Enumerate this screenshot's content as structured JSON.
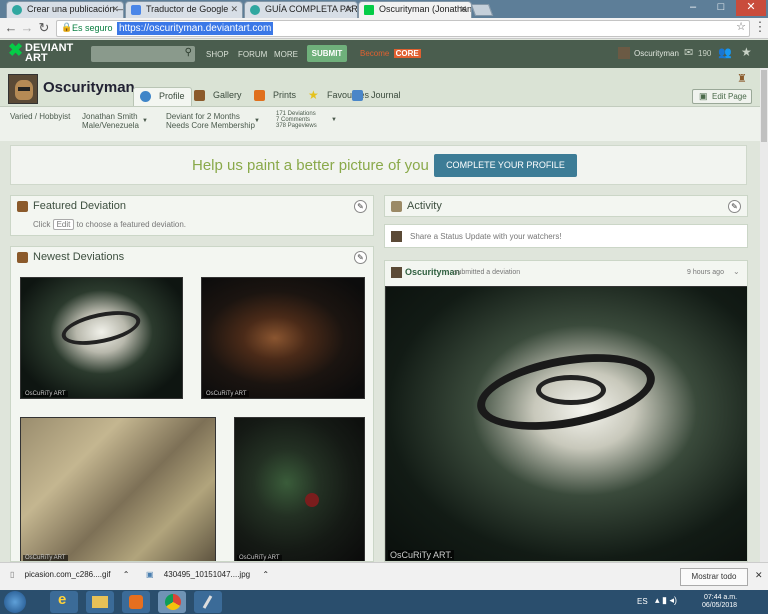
{
  "browser": {
    "tabs": [
      {
        "label": "Crear una publicación —"
      },
      {
        "label": "Traductor de Google"
      },
      {
        "label": "GUÍA COMPLETA PARA R"
      },
      {
        "label": "Oscurityman (Jonathan S"
      }
    ],
    "window_controls": {
      "minimize": "–",
      "maximize": "□",
      "close": "✕"
    },
    "secure_label": "Es seguro",
    "url": "https://oscurityman.deviantart.com"
  },
  "da_header": {
    "logo_line1": "DEVIANT",
    "logo_line2": "ART",
    "nav": [
      "SHOP",
      "FORUM",
      "MORE"
    ],
    "submit": "SUBMIT",
    "become": "Become",
    "core": "CORE",
    "username": "Oscurityman",
    "message_count": "190"
  },
  "profile": {
    "name": "Oscurityman",
    "tabs": [
      "Profile",
      "Gallery",
      "Prints",
      "Favourites",
      "Journal"
    ],
    "edit_page": "Edit Page",
    "info": {
      "type": "Varied / Hobbyist",
      "realname": "Jonathan Smith",
      "location": "Male/Venezuela",
      "deviant_for": "Deviant for 2 Months",
      "core_needed": "Needs Core Membership",
      "deviations": "171 Deviations",
      "comments": "7 Comments",
      "pageviews": "378 Pageviews"
    }
  },
  "banner": {
    "text": "Help us paint a better picture of you",
    "button": "COMPLETE YOUR PROFILE"
  },
  "featured": {
    "title": "Featured Deviation",
    "click": "Click",
    "edit": "Edit",
    "suffix": "to choose a featured deviation."
  },
  "newest": {
    "title": "Newest Deviations",
    "watermark": "OsCuRiTy ART"
  },
  "activity": {
    "title": "Activity",
    "status_placeholder": "Share a Status Update with your watchers!",
    "post_user": "Oscurityman",
    "post_action": "submitted a deviation",
    "post_time": "9 hours ago",
    "watermark": "OsCuRiTy ART."
  },
  "downloads": {
    "items": [
      "picasion.com_c286....gif",
      "430495_10151047....jpg"
    ],
    "show_all": "Mostrar todo"
  },
  "taskbar": {
    "lang": "ES",
    "time": "07:44 a.m.",
    "date": "06/05/2018"
  }
}
